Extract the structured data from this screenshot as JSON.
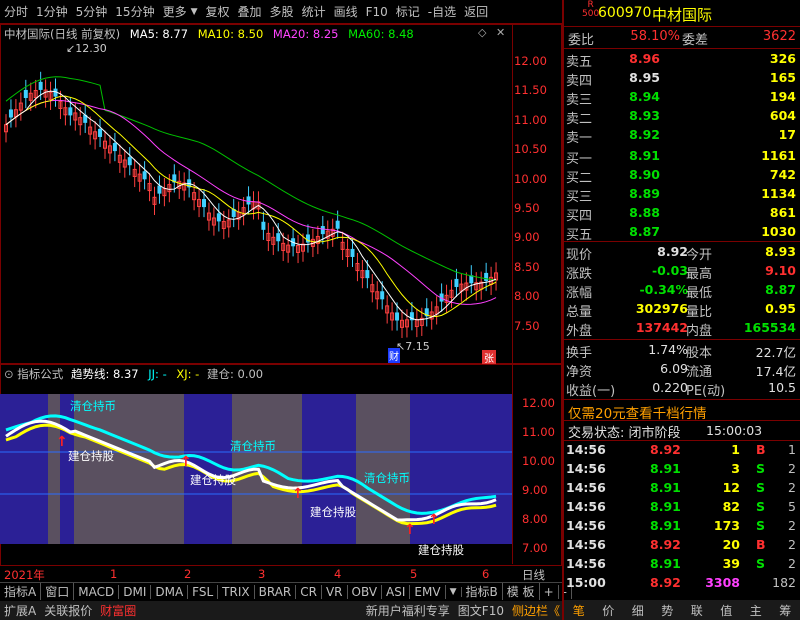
{
  "toolbar": {
    "items": [
      "分时",
      "1分钟",
      "5分钟",
      "15分钟",
      "更多",
      "复权",
      "叠加",
      "多股",
      "统计",
      "画线",
      "F10",
      "标记",
      "-自选",
      "返回"
    ]
  },
  "main_chart": {
    "title": "中材国际(日线 前复权)",
    "ma": [
      {
        "label": "MA5: 8.77",
        "color": "#ffffff"
      },
      {
        "label": "MA10: 8.50",
        "color": "#ffff00"
      },
      {
        "label": "MA20: 8.25",
        "color": "#ff40ff"
      },
      {
        "label": "MA60: 8.48",
        "color": "#00e000"
      }
    ],
    "y_ticks": [
      "12.00",
      "11.50",
      "11.00",
      "10.50",
      "10.00",
      "9.50",
      "9.00",
      "8.50",
      "8.00",
      "7.50"
    ],
    "high_label": "12.30",
    "low_label": "7.15",
    "fin_label": "财",
    "zhang_label": "张"
  },
  "indicator": {
    "title": "指标公式",
    "trend_label": "趋势线: 8.37",
    "jj": "JJ: -",
    "xj": "XJ: -",
    "jc": "建仓: 0.00",
    "y_ticks": [
      "12.00",
      "11.00",
      "10.00",
      "9.00",
      "8.00",
      "7.00"
    ],
    "build_label": "建仓持股",
    "clear_label": "清仓持币"
  },
  "xaxis": {
    "year": "2021年",
    "months": [
      "1",
      "2",
      "3",
      "4",
      "5",
      "6"
    ],
    "period": "日线"
  },
  "tabs": {
    "items": [
      "指标A",
      "窗口",
      "MACD",
      "DMI",
      "DMA",
      "FSL",
      "TRIX",
      "BRAR",
      "CR",
      "VR",
      "OBV",
      "ASI",
      "EMV",
      "指标B",
      "模 板"
    ],
    "plus": "+",
    "minus": "-"
  },
  "bottom": {
    "items": [
      "扩展A",
      "关联报价",
      "财富圈"
    ],
    "right": "新用户福利专享",
    "right2": "图文F10",
    "right3": "侧边栏《"
  },
  "quote": {
    "code": "600970",
    "name": "中材国际",
    "r_label": "R",
    "r_num": "500",
    "wb_label": "委比",
    "wb": "58.10%",
    "wc_label": "委差",
    "wc": "3622",
    "sell": [
      [
        "卖五",
        "8.96",
        "326"
      ],
      [
        "卖四",
        "8.95",
        "165"
      ],
      [
        "卖三",
        "8.94",
        "194"
      ],
      [
        "卖二",
        "8.93",
        "604"
      ],
      [
        "卖一",
        "8.92",
        "17"
      ]
    ],
    "buy": [
      [
        "买一",
        "8.91",
        "1161"
      ],
      [
        "买二",
        "8.90",
        "742"
      ],
      [
        "买三",
        "8.89",
        "1134"
      ],
      [
        "买四",
        "8.88",
        "861"
      ],
      [
        "买五",
        "8.87",
        "1030"
      ]
    ],
    "stats": [
      [
        "现价",
        "8.92",
        "今开",
        "8.93"
      ],
      [
        "涨跌",
        "-0.03",
        "最高",
        "9.10"
      ],
      [
        "涨幅",
        "-0.34%",
        "最低",
        "8.87"
      ],
      [
        "总量",
        "302976",
        "量比",
        "0.95"
      ],
      [
        "外盘",
        "137442",
        "内盘",
        "165534"
      ]
    ],
    "stats2": [
      [
        "换手",
        "1.74%",
        "股本",
        "22.7亿"
      ],
      [
        "净资",
        "6.09",
        "流通",
        "17.4亿"
      ],
      [
        "收益(一)",
        "0.220",
        "PE(动)",
        "10.5"
      ]
    ],
    "promo": "仅需20元查看千档行情",
    "status": "交易状态: 闭市阶段",
    "status_time": "15:00:03",
    "ticks": [
      [
        "14:56",
        "8.92",
        "1",
        "B",
        "1"
      ],
      [
        "14:56",
        "8.91",
        "3",
        "S",
        "2"
      ],
      [
        "14:56",
        "8.91",
        "12",
        "S",
        "2"
      ],
      [
        "14:56",
        "8.91",
        "82",
        "S",
        "5"
      ],
      [
        "14:56",
        "8.91",
        "173",
        "S",
        "2"
      ],
      [
        "14:56",
        "8.92",
        "20",
        "B",
        "2"
      ],
      [
        "14:56",
        "8.91",
        "39",
        "S",
        "2"
      ],
      [
        "15:00",
        "8.92",
        "3308",
        "",
        "182"
      ]
    ],
    "bottom_tabs": [
      "笔",
      "价",
      "细",
      "势",
      "联",
      "值",
      "主",
      "筹"
    ]
  }
}
